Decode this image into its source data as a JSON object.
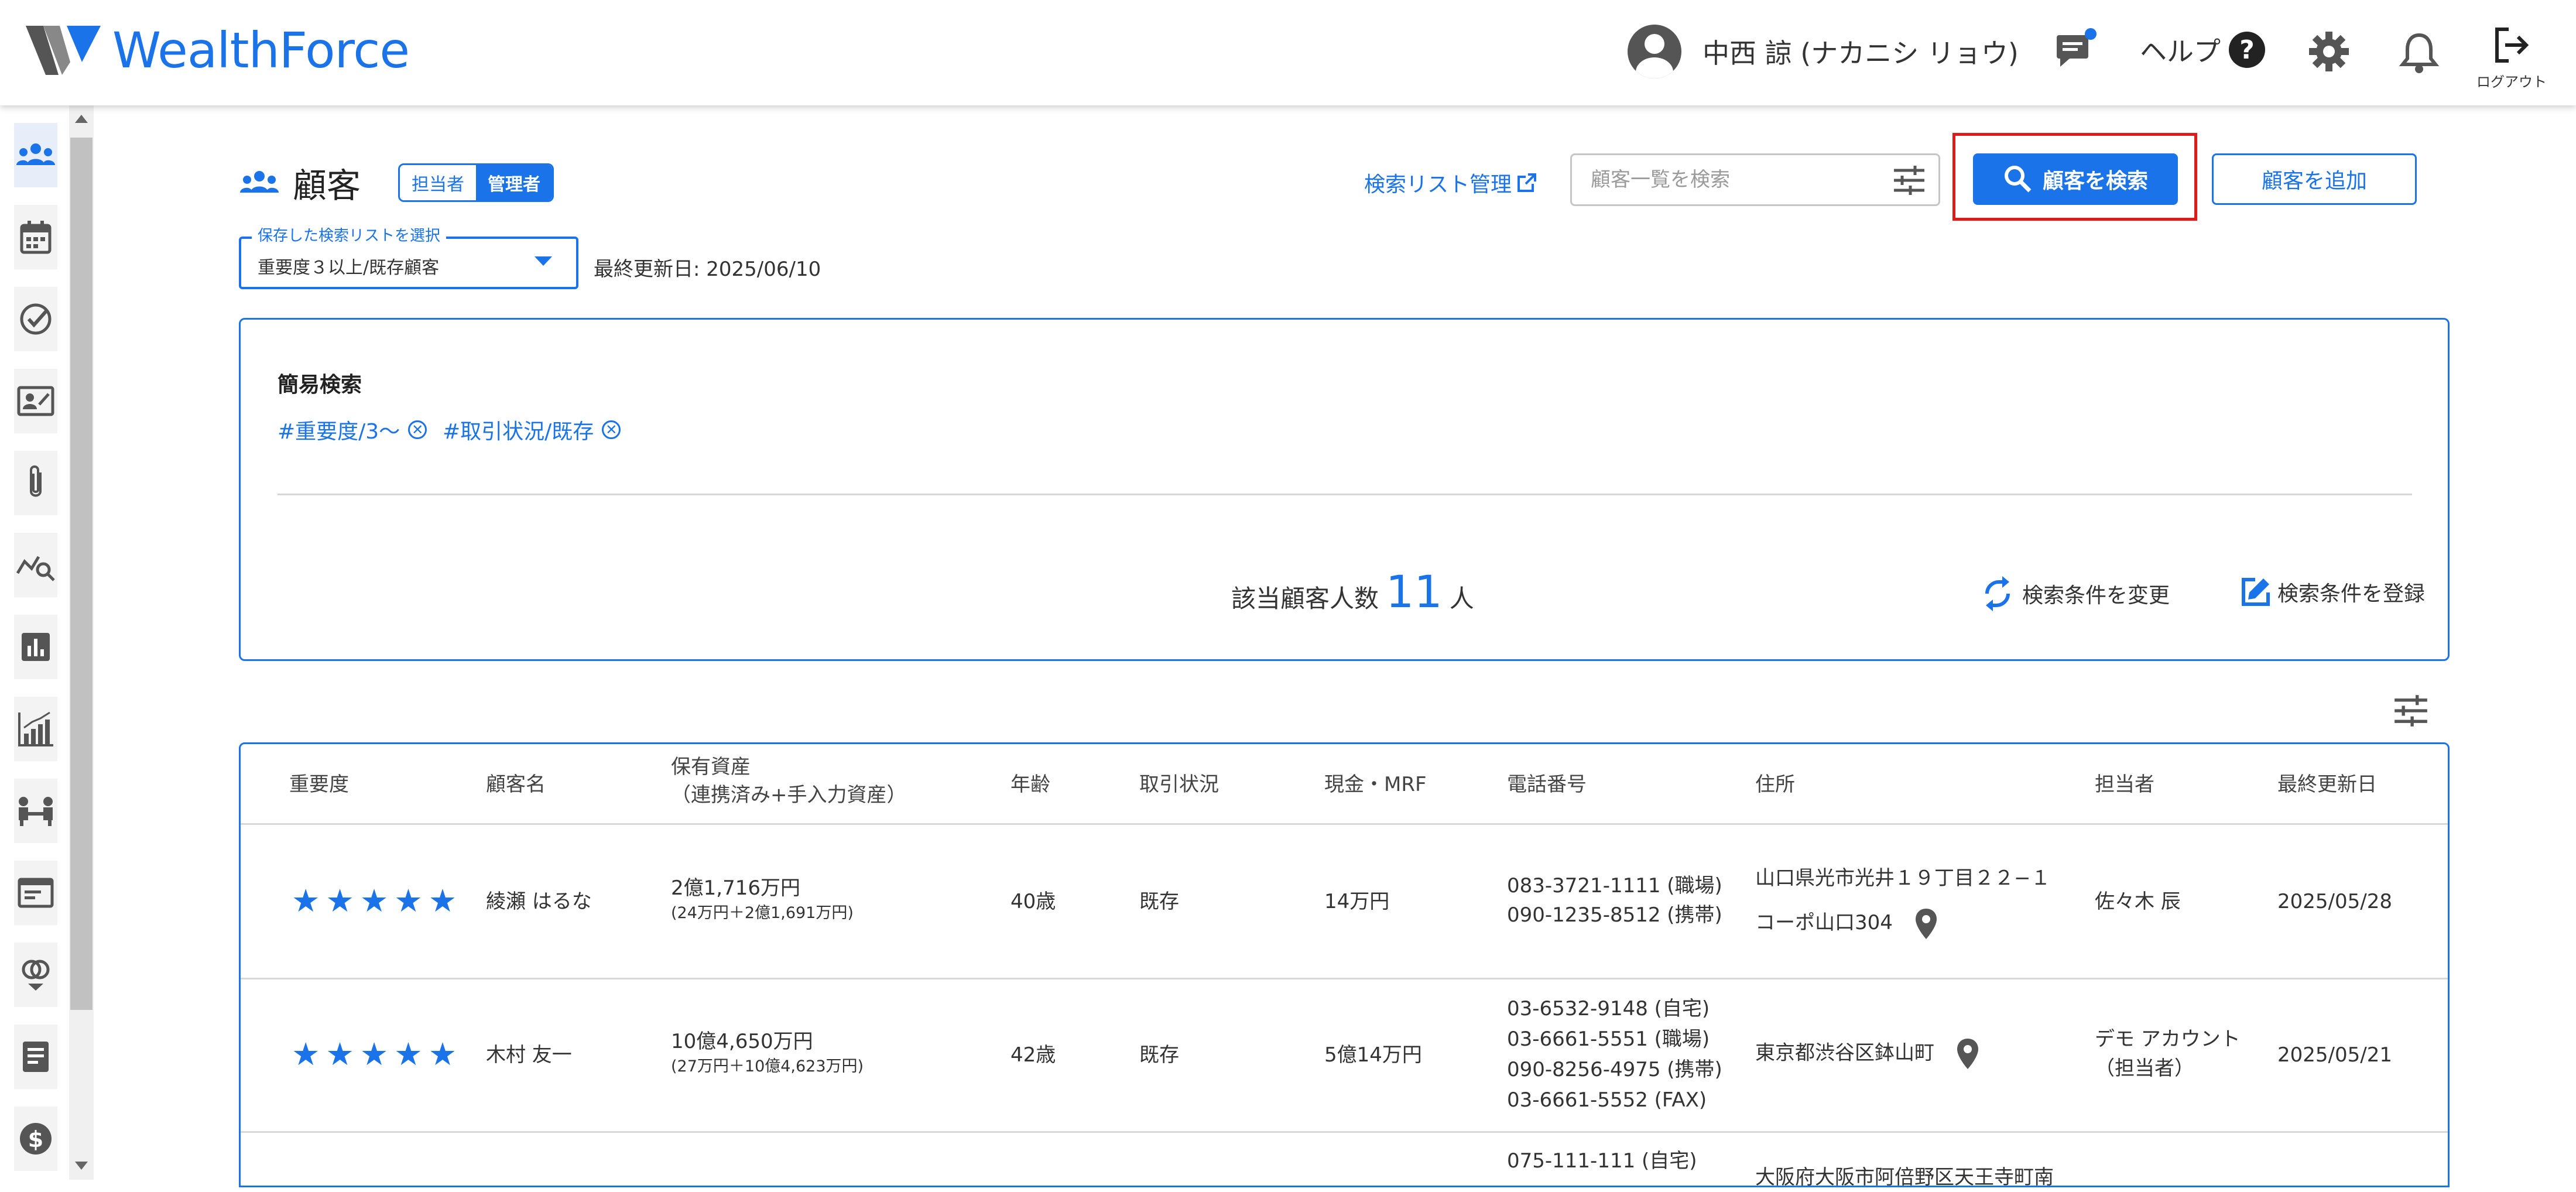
{
  "header": {
    "brand": "WealthForce",
    "user_name": "中西 諒 (ナカニシ リョウ)",
    "help_label": "ヘルプ",
    "help_mark": "?",
    "logout_label": "ログアウト"
  },
  "page": {
    "title": "顧客",
    "role_toggle": [
      "担当者",
      "管理者"
    ],
    "search_list_link": "検索リスト管理",
    "search_placeholder": "顧客一覧を検索",
    "search_button": "顧客を検索",
    "add_button": "顧客を追加",
    "saved_list_legend": "保存した検索リストを選択",
    "saved_list_value": "重要度３以上/既存顧客",
    "last_updated": "最終更新日: 2025/06/10"
  },
  "quick_search": {
    "title": "簡易検索",
    "tags": [
      "#重要度/3〜",
      "#取引状況/既存"
    ],
    "count_prefix": "該当顧客人数",
    "count": "11",
    "count_suffix": "人",
    "change_label": "検索条件を変更",
    "register_label": "検索条件を登録"
  },
  "table": {
    "headers": [
      "重要度",
      "顧客名",
      "保有資産",
      "（連携済み+手入力資産）",
      "年齢",
      "取引状況",
      "現金・MRF",
      "電話番号",
      "住所",
      "担当者",
      "最終更新日"
    ],
    "rows": [
      {
        "stars": 5,
        "name": "綾瀬 はるな",
        "assets": "2億1,716万円",
        "assets_detail": "(24万円＋2億1,691万円)",
        "age": "40歳",
        "status": "既存",
        "cash": "14万円",
        "phone1": "083-3721-1111 (職場)",
        "phone2": "090-1235-8512 (携帯)",
        "address1": "山口県光市光井１９丁目２２−１",
        "address2": "コーポ山口304",
        "manager": "佐々木 辰",
        "updated": "2025/05/28"
      },
      {
        "stars": 5,
        "name": "木村 友一",
        "assets": "10億4,650万円",
        "assets_detail": "(27万円＋10億4,623万円)",
        "age": "42歳",
        "status": "既存",
        "cash": "5億14万円",
        "phone1": "03-6532-9148 (自宅)",
        "phone2": "03-6661-5551 (職場)",
        "phone3": "090-8256-4975 (携帯)",
        "phone4": "03-6661-5552 (FAX)",
        "address1": "東京都渋谷区鉢山町",
        "manager": "デモ アカウント",
        "manager2": "（担当者）",
        "updated": "2025/05/21"
      },
      {
        "phone1": "075-111-111 (自宅)",
        "address1": "大阪府大阪市阿倍野区天王寺町南"
      }
    ]
  },
  "colors": {
    "accent": "#1a73e8",
    "highlight": "#e01a1a"
  }
}
